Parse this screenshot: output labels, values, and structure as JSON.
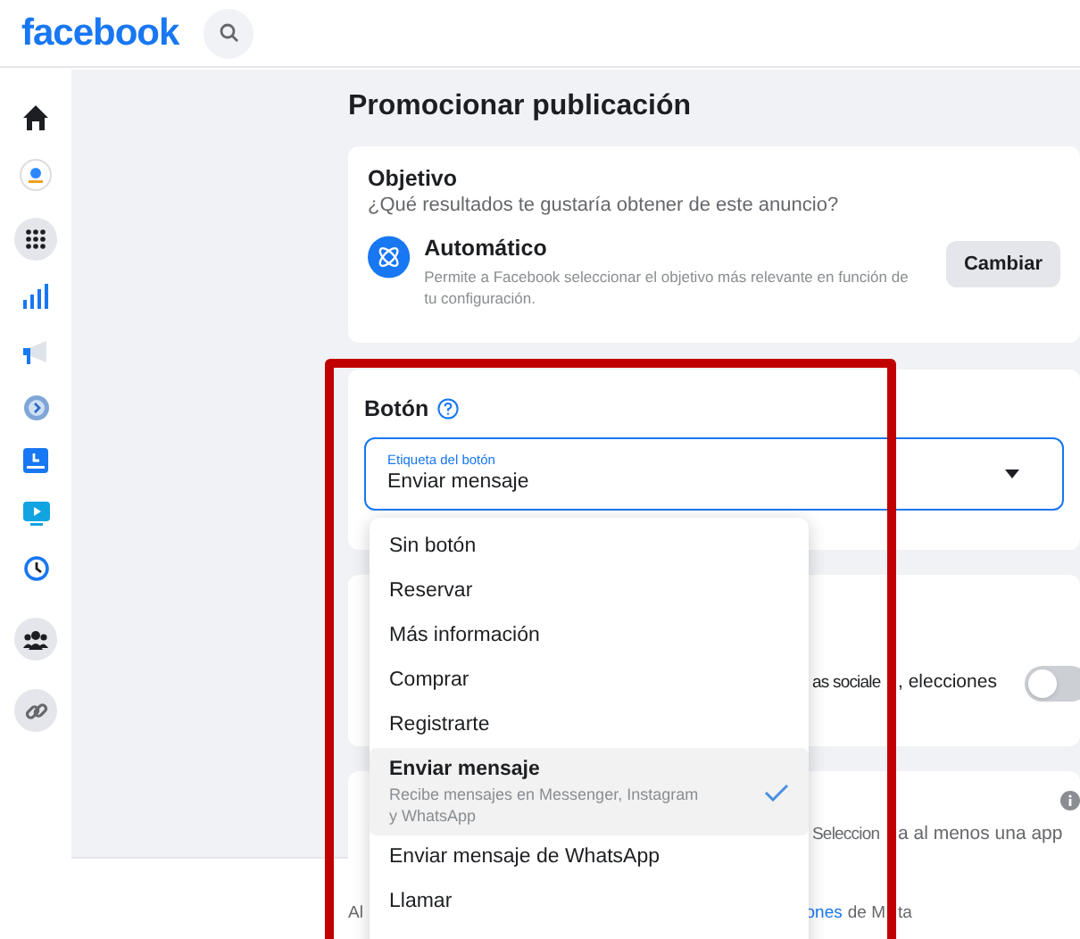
{
  "header": {
    "logo": "facebook"
  },
  "page_title": "Promocionar publicación",
  "objective": {
    "title": "Objetivo",
    "question": "¿Qué resultados te gustaría obtener de este anuncio?",
    "option_title": "Automático",
    "option_description": "Permite a Facebook seleccionar el objetivo más relevante en función de tu configuración.",
    "button": "Cambiar"
  },
  "button_section": {
    "title": "Botón",
    "select": {
      "label": "Etiqueta del botón",
      "value": "Enviar mensaje"
    },
    "options": [
      {
        "label": "Sin botón",
        "selected": false
      },
      {
        "label": "Reservar",
        "selected": false
      },
      {
        "label": "Más información",
        "selected": false
      },
      {
        "label": "Comprar",
        "selected": false
      },
      {
        "label": "Registrarte",
        "selected": false
      },
      {
        "label": "Enviar mensaje",
        "description": "Recibe mensajes en Messenger, Instagram y WhatsApp",
        "selected": true
      },
      {
        "label": "Enviar mensaje de WhatsApp",
        "selected": false
      },
      {
        "label": "Llamar",
        "selected": false
      }
    ]
  },
  "special_category": {
    "text_parts": [
      "as sociale",
      ", elecciones"
    ],
    "on": false
  },
  "apps": {
    "hint_parts": [
      "Seleccion",
      "a al menos una app"
    ]
  },
  "footer": {
    "prefix": "Al",
    "link": "ones",
    "suffix_parts": [
      "de M",
      "ta"
    ]
  }
}
